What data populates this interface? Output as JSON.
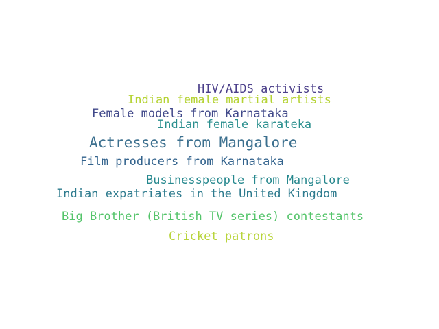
{
  "wordcloud": {
    "words": [
      {
        "text": "HIV/AIDS activists",
        "color": "#4b3f8a"
      },
      {
        "text": "Indian female martial artists",
        "color": "#b5d334"
      },
      {
        "text": "Female models from Karnataka",
        "color": "#41498a"
      },
      {
        "text": "Indian female karateka",
        "color": "#2a8f8e"
      },
      {
        "text": "Actresses from Mangalore",
        "color": "#3b6f8e"
      },
      {
        "text": "Film producers from Karnataka",
        "color": "#33638d"
      },
      {
        "text": "Businesspeople from Mangalore",
        "color": "#26888e"
      },
      {
        "text": "Indian expatriates in the United Kingdom",
        "color": "#2e7b8e"
      },
      {
        "text": "Big Brother (British TV series) contestants",
        "color": "#54c46a"
      },
      {
        "text": "Cricket patrons",
        "color": "#b8d43a"
      }
    ]
  }
}
